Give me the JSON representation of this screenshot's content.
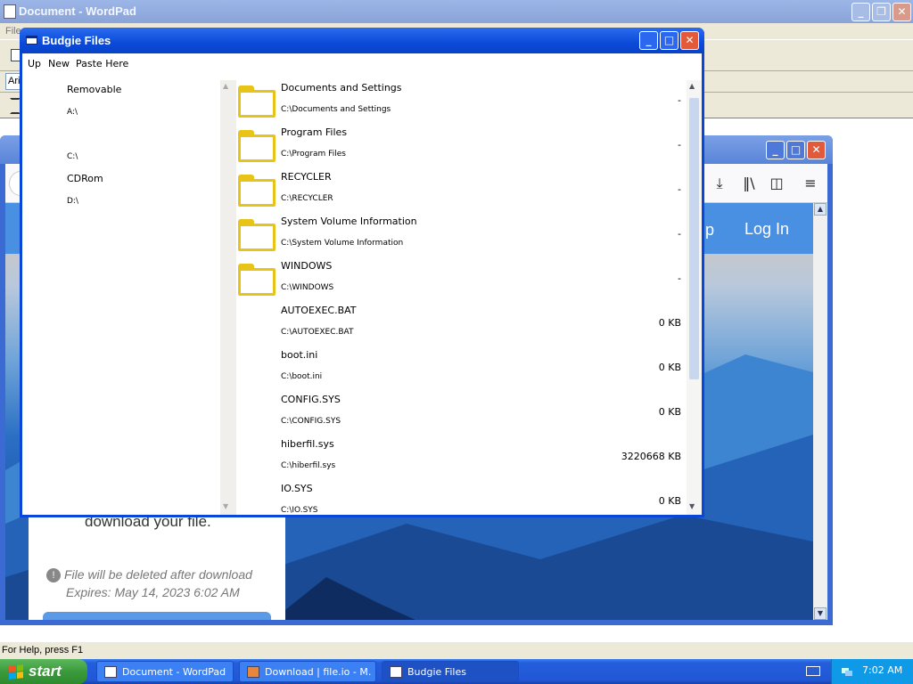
{
  "wordpad": {
    "title": "Document - WordPad",
    "menu_partial": "File",
    "font_partial": "Ari",
    "status": "For Help, press F1"
  },
  "browser": {
    "nav": {
      "signup_partial": "p",
      "login": "Log In"
    },
    "card": {
      "download_text": "download your file.",
      "warning": "File will be deleted after download",
      "expires": "Expires: May 14, 2023 6:02 AM"
    }
  },
  "budgie": {
    "title": "Budgie Files",
    "menu": [
      "Up",
      "New",
      "Paste Here"
    ],
    "sidebar": {
      "removable_label": "Removable",
      "removable_path": "A:\\",
      "c_path": "C:\\",
      "cdrom_label": "CDRom",
      "cdrom_path": "D:\\"
    },
    "files": [
      {
        "name": "Documents and Settings",
        "path": "C:\\Documents and Settings",
        "size": "-",
        "type": "folder"
      },
      {
        "name": "Program Files",
        "path": "C:\\Program Files",
        "size": "-",
        "type": "folder"
      },
      {
        "name": "RECYCLER",
        "path": "C:\\RECYCLER",
        "size": "-",
        "type": "folder"
      },
      {
        "name": "System Volume Information",
        "path": "C:\\System Volume Information",
        "size": "-",
        "type": "folder"
      },
      {
        "name": "WINDOWS",
        "path": "C:\\WINDOWS",
        "size": "-",
        "type": "folder"
      },
      {
        "name": "AUTOEXEC.BAT",
        "path": "C:\\AUTOEXEC.BAT",
        "size": "0 KB",
        "type": "file"
      },
      {
        "name": "boot.ini",
        "path": "C:\\boot.ini",
        "size": "0 KB",
        "type": "file"
      },
      {
        "name": "CONFIG.SYS",
        "path": "C:\\CONFIG.SYS",
        "size": "0 KB",
        "type": "file"
      },
      {
        "name": "hiberfil.sys",
        "path": "C:\\hiberfil.sys",
        "size": "3220668 KB",
        "type": "file"
      },
      {
        "name": "IO.SYS",
        "path": "C:\\IO.SYS",
        "size": "0 KB",
        "type": "file"
      }
    ]
  },
  "taskbar": {
    "start_label": "start",
    "tasks": [
      {
        "label": "Document - WordPad"
      },
      {
        "label": "Download | file.io - M..."
      },
      {
        "label": "Budgie Files"
      }
    ],
    "clock": "7:02 AM"
  },
  "colors": {
    "xp_blue": "#0a47d8",
    "folder_yellow": "#e8c318",
    "start_green": "#3a9a3a",
    "nav_blue": "#4a90e2"
  }
}
